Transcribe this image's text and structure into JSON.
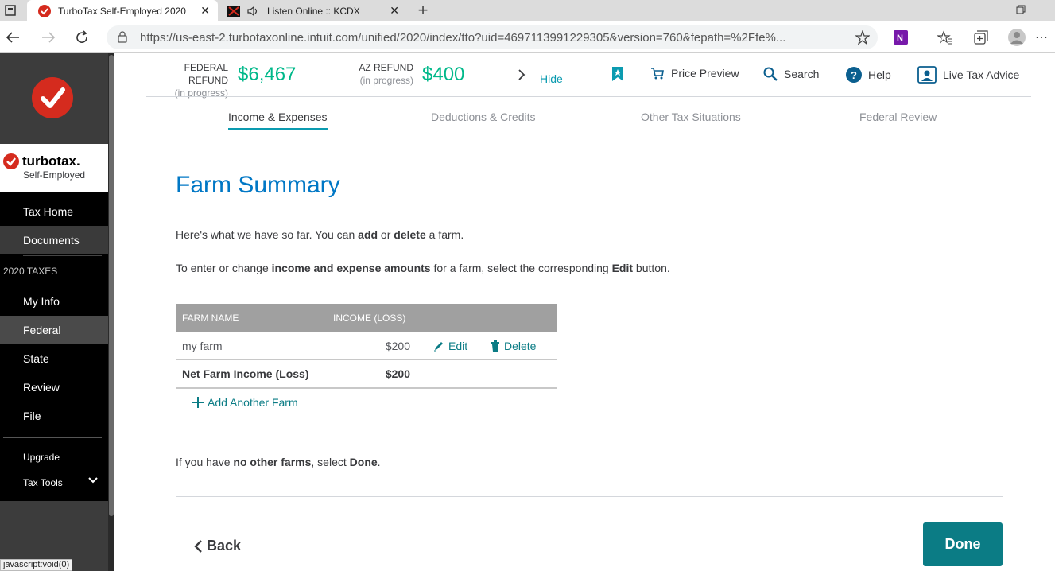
{
  "browser": {
    "tabs": [
      {
        "title": "TurboTax Self-Employed 2020"
      },
      {
        "title": "Listen Online :: KCDX"
      }
    ],
    "new_tab": "+",
    "url": "https://us-east-2.turbotaxonline.intuit.com/unified/2020/index/tto?uid=4697113991229305&version=760&fepath=%2Ffe%..."
  },
  "sidebar": {
    "brand_name": "turbotax.",
    "brand_sub": "Self-Employed",
    "items": [
      {
        "label": "Tax Home"
      },
      {
        "label": "Documents"
      },
      {
        "label": "2020 TAXES"
      },
      {
        "label": "My Info"
      },
      {
        "label": "Federal"
      },
      {
        "label": "State"
      },
      {
        "label": "Review"
      },
      {
        "label": "File"
      },
      {
        "label": "Upgrade"
      },
      {
        "label": "Tax Tools"
      }
    ]
  },
  "header": {
    "federal_label": "FEDERAL REFUND",
    "federal_sub": "(in progress)",
    "federal_amount": "$6,467",
    "az_label": "AZ REFUND",
    "az_sub": "(in progress)",
    "az_amount": "$400",
    "hide": "Hide",
    "price_preview": "Price Preview",
    "search": "Search",
    "help": "Help",
    "live_advice": "Live Tax Advice"
  },
  "nav_tabs": [
    {
      "label": "Income & Expenses"
    },
    {
      "label": "Deductions & Credits"
    },
    {
      "label": "Other Tax Situations"
    },
    {
      "label": "Federal Review"
    }
  ],
  "main": {
    "title": "Farm Summary",
    "p1": {
      "a": "Here's what we have so far. You can ",
      "b": "add",
      "c": " or ",
      "d": "delete",
      "e": " a farm."
    },
    "p2": {
      "a": "To enter or change ",
      "b": "income and expense amounts",
      "c": " for a farm, select the corresponding ",
      "d": "Edit",
      "e": " button."
    },
    "table": {
      "headers": [
        "FARM NAME",
        "INCOME (LOSS)"
      ],
      "rows": [
        {
          "name": "my farm",
          "income": "$200",
          "edit": "Edit",
          "delete": "Delete"
        }
      ],
      "total_label": "Net Farm Income (Loss)",
      "total_value": "$200",
      "add_another": "Add Another Farm"
    },
    "p3": {
      "a": "If you have ",
      "b": "no other farms",
      "c": ", select ",
      "d": "Done",
      "e": "."
    },
    "back": "Back",
    "done": "Done"
  },
  "status_tip": "javascript:void(0)",
  "colors": {
    "brand": "#d52b1e",
    "accent": "#0077c5",
    "refund": "#00b88a",
    "teal": "#0b7c85"
  }
}
